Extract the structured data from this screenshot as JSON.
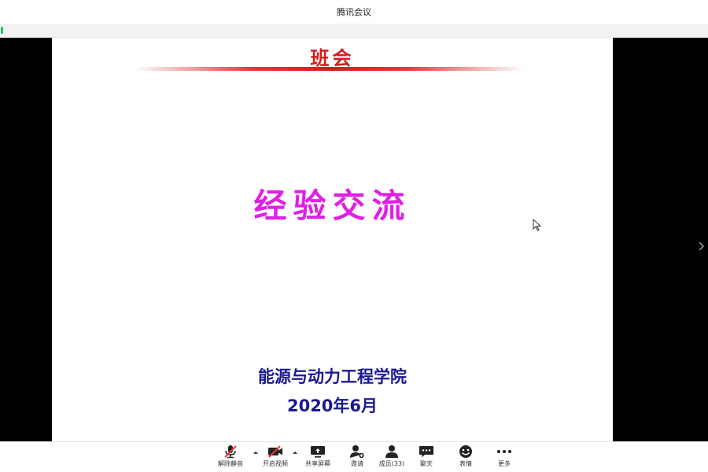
{
  "window": {
    "title": "腾讯会议"
  },
  "slide": {
    "header": "班会",
    "main_text": "经验交流",
    "org": "能源与动力工程学院",
    "date": "2020年6月"
  },
  "toolbar": {
    "unmute": "解除静音",
    "start_video": "开启视频",
    "share_screen": "共享屏幕",
    "invite": "邀请",
    "members": "成员(33)",
    "chat": "聊天",
    "emoji": "表情",
    "more": "更多"
  },
  "colors": {
    "header_red": "#d71a1a",
    "main_magenta": "#e11ee6",
    "footer_navy": "#1a1896",
    "mute_red": "#e53935",
    "signal_green": "#22c55e"
  }
}
